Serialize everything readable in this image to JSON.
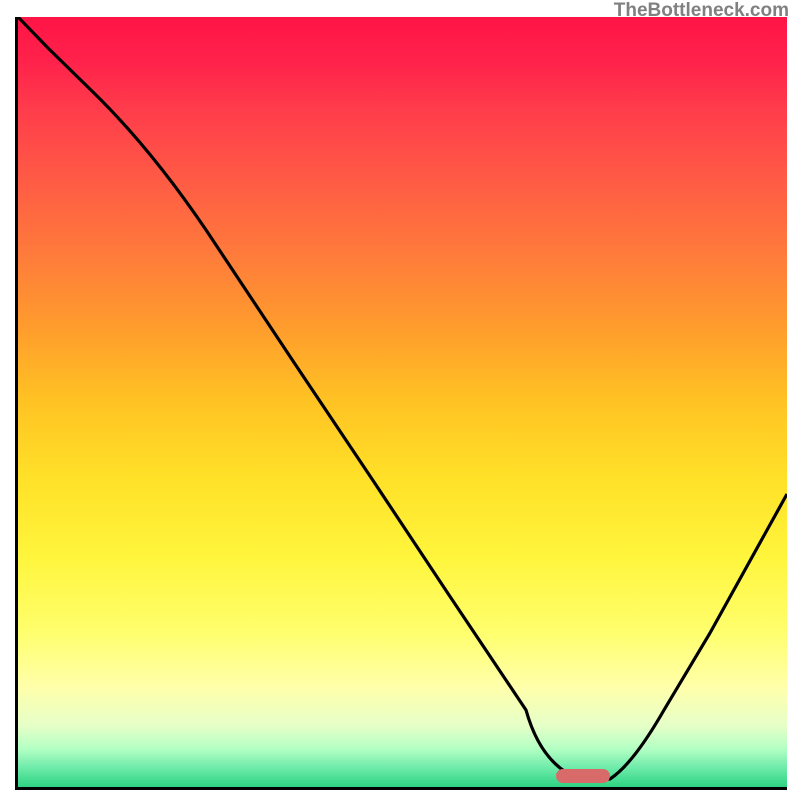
{
  "branding": "TheBottleneck.com",
  "chart_data": {
    "type": "line",
    "title": "",
    "xlabel": "",
    "ylabel": "",
    "xlim": [
      0,
      100
    ],
    "ylim": [
      0,
      100
    ],
    "grid": false,
    "legend_position": "none",
    "background_gradient": {
      "description": "Vertical gradient representing bottleneck severity",
      "stops": [
        {
          "pos": 0,
          "color": "#ff1446",
          "meaning": "high bottleneck"
        },
        {
          "pos": 50,
          "color": "#ffc323",
          "meaning": "medium bottleneck"
        },
        {
          "pos": 80,
          "color": "#ffff6e",
          "meaning": "low bottleneck"
        },
        {
          "pos": 100,
          "color": "#2dd282",
          "meaning": "no bottleneck"
        }
      ]
    },
    "series": [
      {
        "name": "bottleneck-curve",
        "x": [
          0,
          4,
          10,
          18,
          26,
          36,
          46,
          56,
          66,
          68,
          73,
          77,
          80,
          84,
          90,
          100
        ],
        "values": [
          100,
          96,
          90,
          81,
          70,
          55,
          40,
          25,
          10,
          3,
          1,
          1,
          3,
          10,
          20,
          38
        ]
      }
    ],
    "optimal_marker": {
      "x_range": [
        70,
        77
      ],
      "y": 2,
      "color": "#d86a6a",
      "meaning": "optimal configuration zone"
    }
  }
}
